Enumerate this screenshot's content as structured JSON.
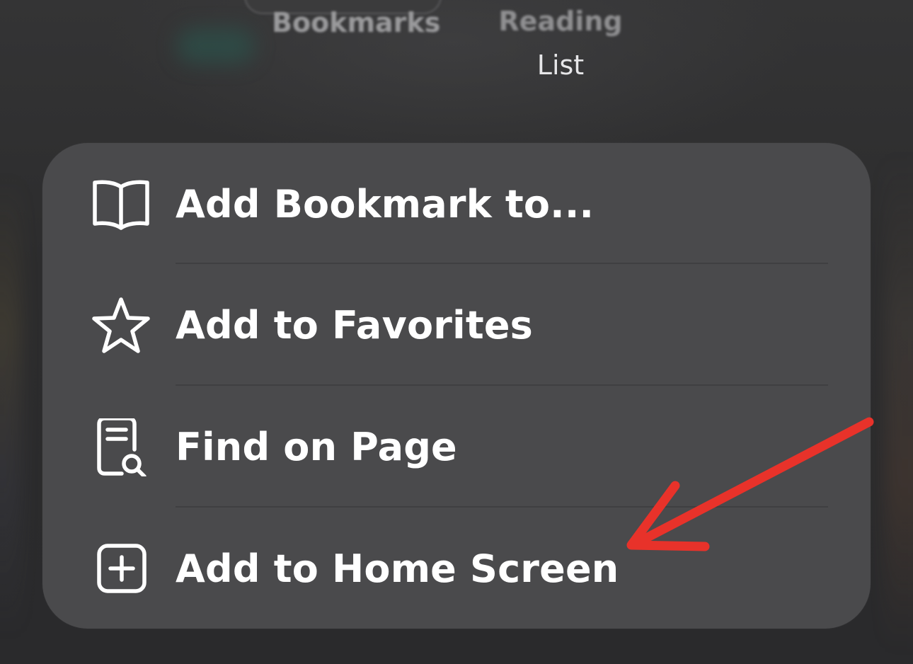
{
  "top_tabs": {
    "bookmarks_label": "Bookmarks",
    "reading_list_line1": "Reading",
    "reading_list_line2": "List"
  },
  "menu": {
    "items": [
      {
        "label": "Add Bookmark to...",
        "icon": "book-icon"
      },
      {
        "label": "Add to Favorites",
        "icon": "star-icon"
      },
      {
        "label": "Find on Page",
        "icon": "find-document-icon"
      },
      {
        "label": "Add to Home Screen",
        "icon": "plus-square-icon"
      }
    ]
  },
  "colors": {
    "menu_background": "#4a4a4c",
    "page_background": "#2a2a2b",
    "text": "#ffffff",
    "annotation_arrow": "#e8322a"
  }
}
